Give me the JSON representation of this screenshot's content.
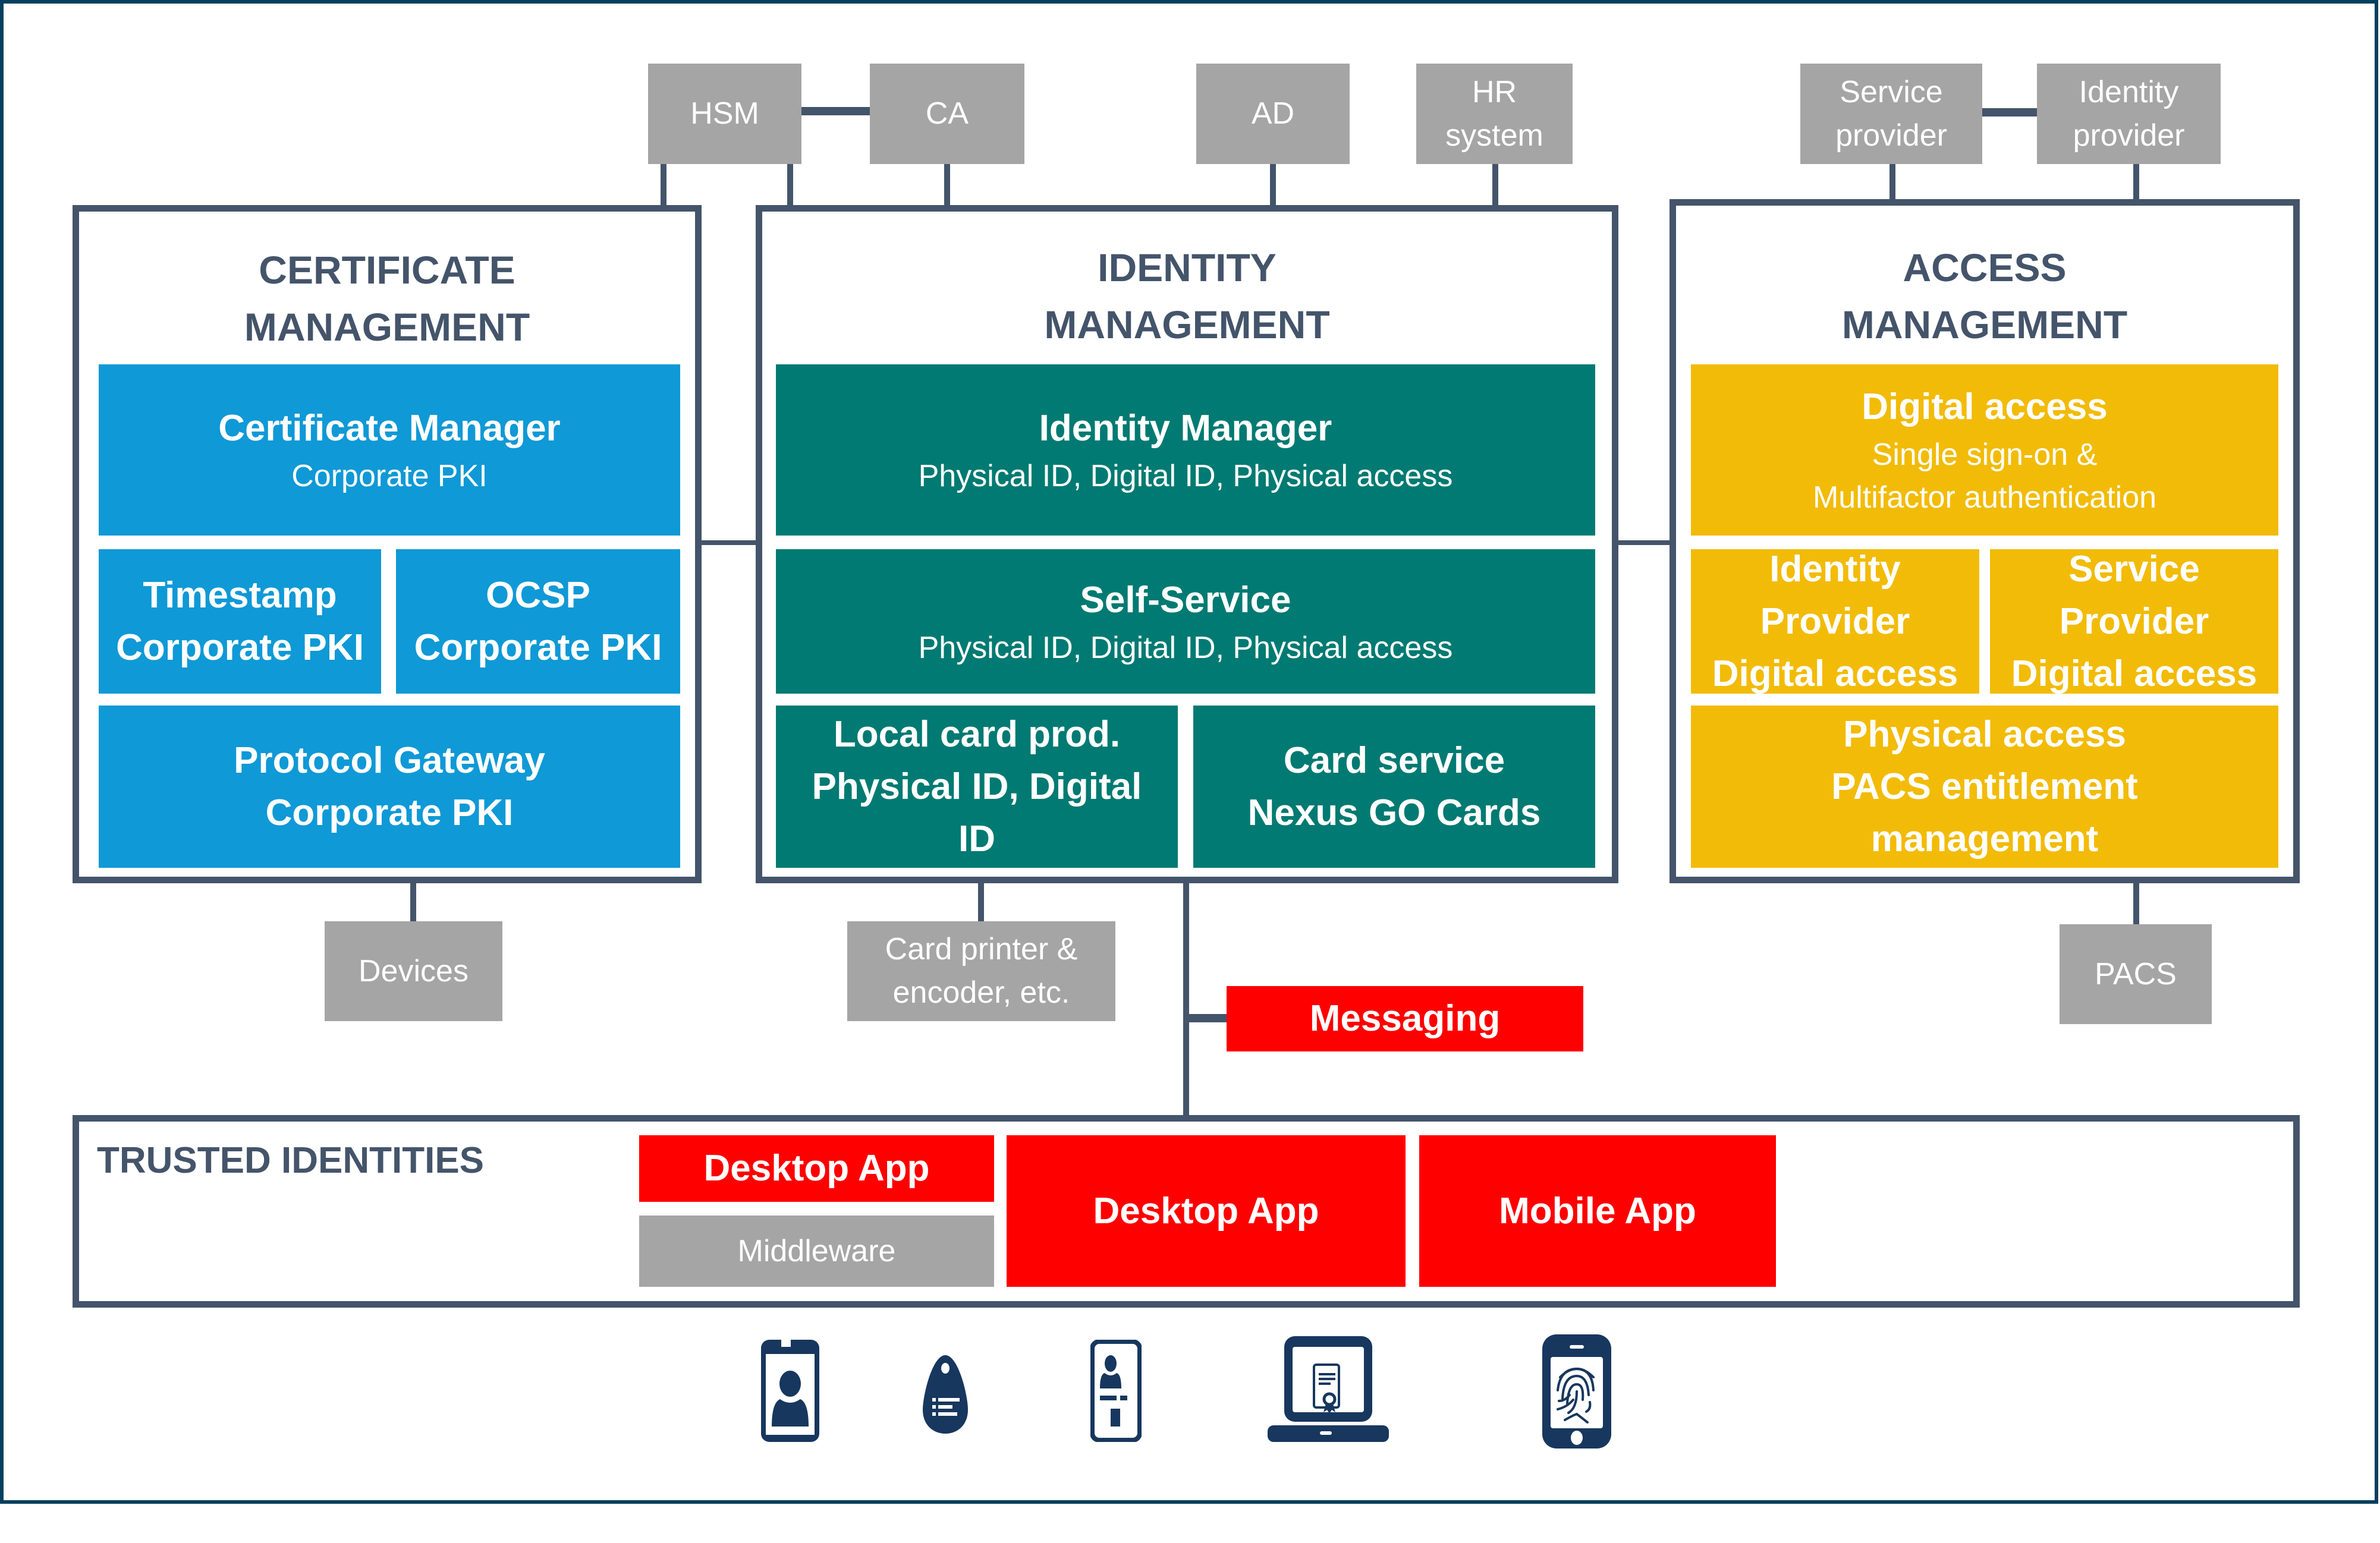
{
  "colors": {
    "frame": "#033f5e",
    "connector": "#44546a",
    "external_system": "#a5a5a5",
    "certificate": "#0f99d6",
    "identity": "#007a72",
    "access": "#f2bb07",
    "app": "#fe0000",
    "icon": "#17375e"
  },
  "external_systems_top": {
    "hsm": "HSM",
    "ca": "CA",
    "ad": "AD",
    "hr": "HR\nsystem",
    "service_provider": "Service\nprovider",
    "identity_provider": "Identity\nprovider"
  },
  "certificate_management": {
    "title": "CERTIFICATE\nMANAGEMENT",
    "blocks": [
      {
        "title": "Certificate Manager",
        "subtitle": "Corporate PKI"
      },
      {
        "title": "Timestamp\nCorporate PKI"
      },
      {
        "title": "OCSP\nCorporate PKI"
      },
      {
        "title": "Protocol Gateway\nCorporate PKI"
      }
    ]
  },
  "identity_management": {
    "title": "IDENTITY\nMANAGEMENT",
    "blocks": [
      {
        "title": "Identity Manager",
        "subtitle": "Physical ID, Digital ID, Physical access"
      },
      {
        "title": "Self-Service",
        "subtitle": "Physical ID, Digital ID, Physical access"
      },
      {
        "title": "Local card prod.\nPhysical ID, Digital\nID"
      },
      {
        "title": "Card service\nNexus GO Cards"
      }
    ]
  },
  "access_management": {
    "title": "ACCESS\nMANAGEMENT",
    "blocks": [
      {
        "title": "Digital access",
        "subtitle": "Single sign-on &\nMultifactor authentication"
      },
      {
        "title": "Identity\nProvider\nDigital access"
      },
      {
        "title": "Service\nProvider\nDigital access"
      },
      {
        "title": "Physical access\nPACS entitlement\nmanagement"
      }
    ]
  },
  "external_systems_bottom": {
    "devices": "Devices",
    "card_printer": "Card printer &\nencoder, etc.",
    "pacs": "PACS"
  },
  "messaging": "Messaging",
  "trusted_identities": {
    "title": "TRUSTED IDENTITIES",
    "desktop_app_small": "Desktop App",
    "middleware": "Middleware",
    "desktop_app": "Desktop App",
    "mobile_app": "Mobile App"
  },
  "device_icons": [
    "mobile-id-icon",
    "key-fob-tag-icon",
    "id-badge-icon",
    "laptop-certificate-icon",
    "smartphone-fingerprint-icon"
  ]
}
